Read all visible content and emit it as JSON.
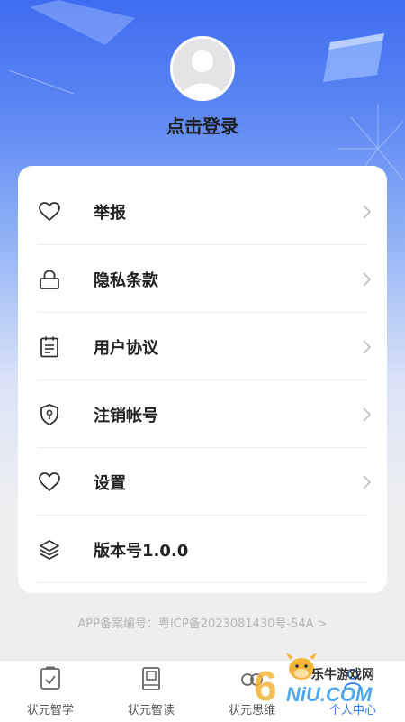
{
  "profile": {
    "login_text": "点击登录"
  },
  "menu": {
    "items": [
      {
        "label": "举报",
        "icon": "heart-icon",
        "has_arrow": true
      },
      {
        "label": "隐私条款",
        "icon": "lock-icon",
        "has_arrow": true
      },
      {
        "label": "用户协议",
        "icon": "document-icon",
        "has_arrow": true
      },
      {
        "label": "注销帐号",
        "icon": "shield-icon",
        "has_arrow": true
      },
      {
        "label": "设置",
        "icon": "heart-icon",
        "has_arrow": true
      },
      {
        "label": "版本号1.0.0",
        "icon": "layers-icon",
        "has_arrow": false
      }
    ]
  },
  "footer": {
    "icp_text": "APP备案编号：粤ICP备2023081430号-54A  >"
  },
  "tabbar": {
    "tabs": [
      {
        "label": "状元智学",
        "icon": "check-document-icon"
      },
      {
        "label": "状元智读",
        "icon": "book-icon"
      },
      {
        "label": "状元思维",
        "icon": "infinity-icon"
      },
      {
        "label": "个人中心",
        "icon": "person-icon",
        "active": true
      }
    ]
  },
  "watermark": {
    "brand": "乐牛游戏网",
    "logo_text": "NiU.COM",
    "digit": "6"
  },
  "colors": {
    "header_blue": "#3f6cf0",
    "accent_blue": "#2f7cf6",
    "icp_gray": "#b5b5b5"
  }
}
